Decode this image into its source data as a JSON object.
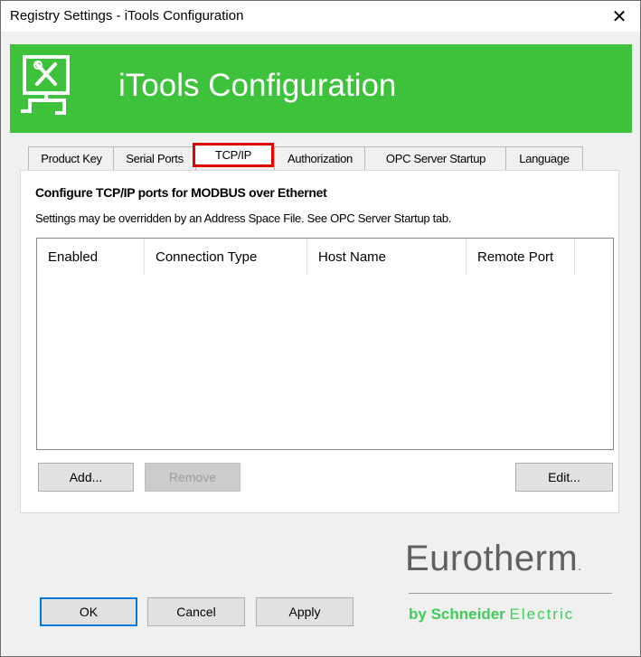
{
  "window": {
    "title": "Registry Settings - iTools Configuration",
    "close_glyph": "✕"
  },
  "banner": {
    "title": "iTools Configuration",
    "icon": "tools-monitor-icon",
    "color": "#3ec23c"
  },
  "tabs": [
    {
      "label": "Product Key"
    },
    {
      "label": "Serial Ports"
    },
    {
      "label": "TCP/IP",
      "active": true
    },
    {
      "label": "Authorization"
    },
    {
      "label": "OPC Server Startup"
    },
    {
      "label": "Language"
    }
  ],
  "panel": {
    "heading": "Configure TCP/IP ports for MODBUS over Ethernet",
    "note": "Settings may be overridden by an Address Space File.  See OPC Server Startup tab.",
    "columns": [
      "Enabled",
      "Connection Type",
      "Host Name",
      "Remote Port"
    ],
    "add_label": "Add...",
    "remove_label": "Remove",
    "edit_label": "Edit..."
  },
  "footer": {
    "ok_label": "OK",
    "cancel_label": "Cancel",
    "apply_label": "Apply"
  },
  "brand": {
    "name": "Eurotherm",
    "dot": ".",
    "by": "by",
    "schneider": "Schneider",
    "electric": "Electric"
  }
}
